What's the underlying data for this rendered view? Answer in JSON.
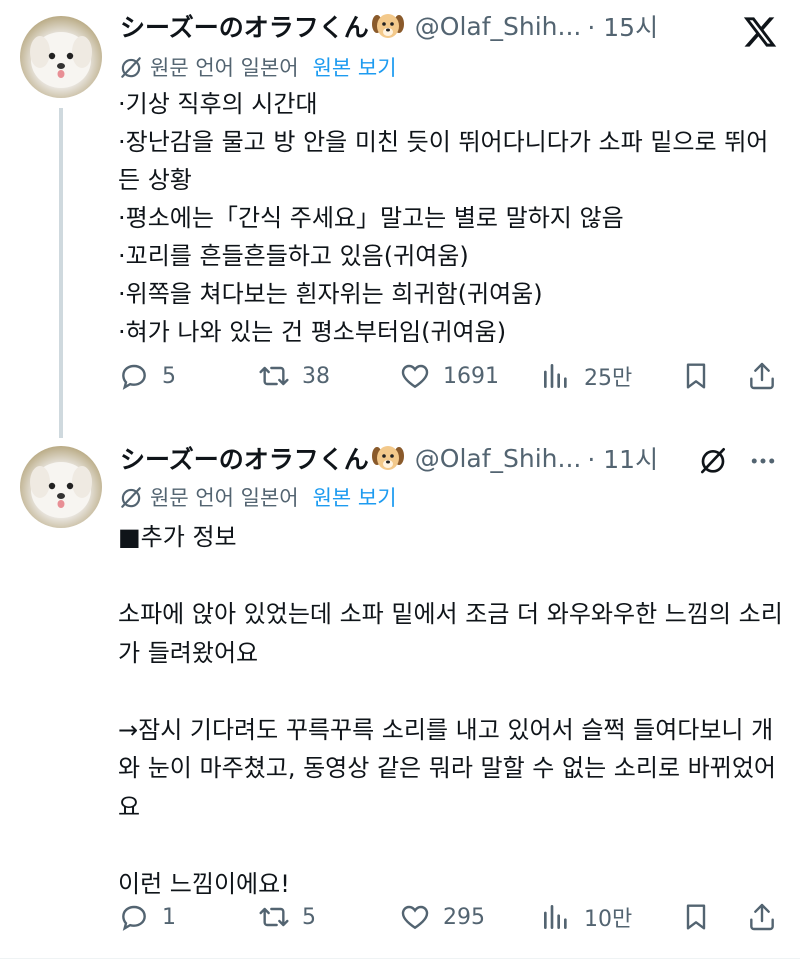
{
  "tweets": [
    {
      "display_name": "シーズーのオラフくん",
      "handle": "@Olaf_Shih...",
      "time": "· 15시",
      "translate": {
        "label": "원문 언어 일본어",
        "link": "원본 보기"
      },
      "text": "·기상 직후의 시간대\n·장난감을 물고 방 안을 미친 듯이 뛰어다니다가 소파 밑으로 뛰어든 상황\n·평소에는「간식 주세요」말고는 별로 말하지 않음\n·꼬리를 흔들흔들하고 있음(귀여움)\n·위쪽을 쳐다보는 흰자위는 희귀함(귀여움)\n·혀가 나와 있는 건 평소부터임(귀여움)",
      "stats": {
        "replies": "5",
        "retweets": "38",
        "likes": "1691",
        "views": "25만"
      }
    },
    {
      "display_name": "シーズーのオラフくん",
      "handle": "@Olaf_Shih...",
      "time": "· 11시",
      "translate": {
        "label": "원문 언어 일본어",
        "link": "원본 보기"
      },
      "text": "■추가 정보\n\n소파에 앉아 있었는데 소파 밑에서 조금 더 와우와우한 느낌의 소리가 들려왔어요\n\n→잠시 기다려도 꾸륵꾸륵 소리를 내고 있어서 슬쩍 들여다보니 개와 눈이 마주쳤고, 동영상 같은 뭐라 말할 수 없는 소리로 바뀌었어요\n\n이런 느낌이에요!",
      "stats": {
        "replies": "1",
        "retweets": "5",
        "likes": "295",
        "views": "10만"
      }
    }
  ],
  "icons": {
    "reply": "reply-icon",
    "retweet": "retweet-icon",
    "like": "heart-icon",
    "views": "views-icon",
    "bookmark": "bookmark-icon",
    "share": "share-icon",
    "x_logo": "x-logo-icon",
    "grok": "grok-icon",
    "more": "more-icon",
    "translate": "translate-icon"
  },
  "colors": {
    "text": "#0f1419",
    "secondary": "#536471",
    "link": "#1d9bf0",
    "thread_line": "#cfd9de"
  }
}
